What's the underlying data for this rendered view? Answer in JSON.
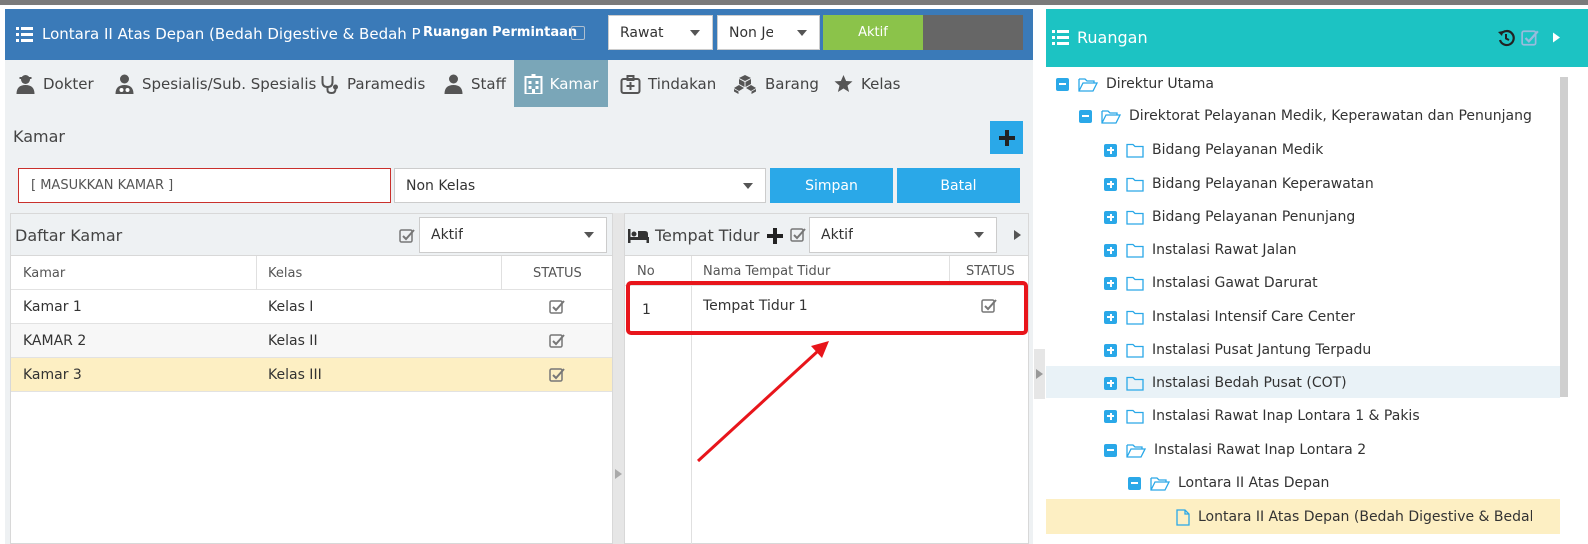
{
  "header": {
    "title": "Lontara II Atas Depan (Bedah Digestive & Bedah Plastik)",
    "ruangan_permintaan_label": "Ruangan Permintaan",
    "select_rawat": "Rawat",
    "select_jenis": "Non Jenis",
    "aktif_button": "Aktif"
  },
  "tabs": [
    {
      "label": "Dokter",
      "icon": "doctor-icon"
    },
    {
      "label": "Spesialis/Sub. Spesialis",
      "icon": "user-md-icon"
    },
    {
      "label": "Paramedis",
      "icon": "stethoscope-icon"
    },
    {
      "label": "Staff",
      "icon": "user-icon"
    },
    {
      "label": "Kamar",
      "icon": "hospital-icon",
      "active": true
    },
    {
      "label": "Tindakan",
      "icon": "medkit-icon"
    },
    {
      "label": "Barang",
      "icon": "cubes-icon"
    },
    {
      "label": "Kelas",
      "icon": "star-icon"
    }
  ],
  "kamar_form": {
    "section_title": "Kamar",
    "kamar_placeholder": "[ MASUKKAN KAMAR ]",
    "kelas_value": "Non Kelas",
    "simpan_label": "Simpan",
    "batal_label": "Batal"
  },
  "daftar_kamar": {
    "title": "Daftar Kamar",
    "filter": "Aktif",
    "columns": [
      "Kamar",
      "Kelas",
      "STATUS"
    ],
    "rows": [
      {
        "kamar": "Kamar 1",
        "kelas": "Kelas I",
        "status": true
      },
      {
        "kamar": "KAMAR 2",
        "kelas": "Kelas II",
        "status": true
      },
      {
        "kamar": "Kamar 3",
        "kelas": "Kelas III",
        "status": true,
        "selected": true
      }
    ]
  },
  "tempat_tidur": {
    "title": "Tempat Tidur",
    "filter": "Aktif",
    "columns": [
      "No",
      "Nama Tempat Tidur",
      "STATUS"
    ],
    "rows": [
      {
        "no": "1",
        "nama": "Tempat Tidur 1",
        "status": true
      }
    ]
  },
  "ruangan": {
    "title": "Ruangan",
    "tree": [
      {
        "label": "Direktur Utama",
        "level": 0,
        "toggle": "minus",
        "folder": "open"
      },
      {
        "label": "Direktorat Pelayanan Medik, Keperawatan dan Penunjang",
        "level": 1,
        "toggle": "minus",
        "folder": "open"
      },
      {
        "label": "Bidang Pelayanan Medik",
        "level": 2,
        "toggle": "plus",
        "folder": "closed"
      },
      {
        "label": "Bidang Pelayanan Keperawatan",
        "level": 2,
        "toggle": "plus",
        "folder": "closed"
      },
      {
        "label": "Bidang Pelayanan Penunjang",
        "level": 2,
        "toggle": "plus",
        "folder": "closed"
      },
      {
        "label": "Instalasi Rawat Jalan",
        "level": 2,
        "toggle": "plus",
        "folder": "closed"
      },
      {
        "label": "Instalasi Gawat Darurat",
        "level": 2,
        "toggle": "plus",
        "folder": "closed"
      },
      {
        "label": "Instalasi Intensif Care Center",
        "level": 2,
        "toggle": "plus",
        "folder": "closed"
      },
      {
        "label": "Instalasi Pusat Jantung Terpadu",
        "level": 2,
        "toggle": "plus",
        "folder": "closed"
      },
      {
        "label": "Instalasi Bedah Pusat (COT)",
        "level": 2,
        "toggle": "plus",
        "folder": "closed",
        "hover": true
      },
      {
        "label": "Instalasi Rawat Inap Lontara 1 & Pakis",
        "level": 2,
        "toggle": "plus",
        "folder": "closed"
      },
      {
        "label": "Instalasi Rawat Inap Lontara 2",
        "level": 2,
        "toggle": "minus",
        "folder": "open"
      },
      {
        "label": "Lontara II Atas Depan",
        "level": 3,
        "toggle": "minus",
        "folder": "open"
      },
      {
        "label": "Lontara II Atas Depan (Bedah Digestive & Bedah Plastik)",
        "level": 4,
        "toggle": "none",
        "folder": "file",
        "selected": true
      }
    ]
  },
  "colors": {
    "header_blue": "#3a7ab8",
    "ruangan_teal": "#1cc3c3",
    "accent_blue": "#2aa8e8",
    "aktif_green": "#8bc34a",
    "selected_row": "#fdefc3",
    "highlight_red": "#e8151b"
  }
}
